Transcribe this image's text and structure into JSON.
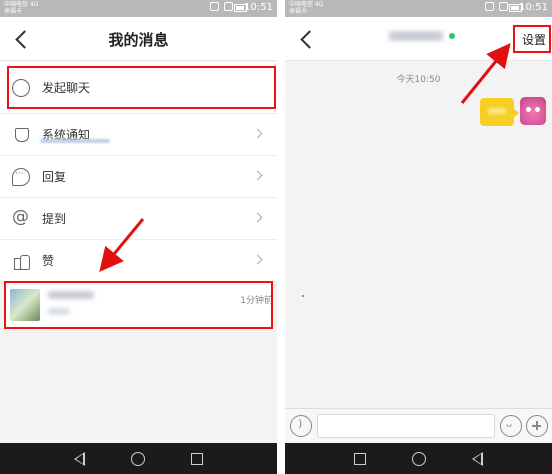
{
  "left_screen": {
    "status": {
      "carrier_line1": "中国电信 4G",
      "carrier_line2": "来福卡",
      "time": "10:51"
    },
    "title": "我的消息",
    "rows": [
      {
        "label": "发起聊天",
        "icon": "chat-bubble-icon"
      },
      {
        "label": "系统通知",
        "icon": "bell-icon"
      },
      {
        "label": "回复",
        "icon": "comment-icon"
      },
      {
        "label": "提到",
        "icon": "at-icon"
      },
      {
        "label": "赞",
        "icon": "thumbs-up-icon"
      }
    ],
    "chat_item": {
      "time": "1分钟前"
    }
  },
  "right_screen": {
    "status": {
      "carrier_line1": "中国电信 4G",
      "carrier_line2": "来福卡",
      "time": "10:51"
    },
    "settings_label": "设置",
    "timestamp": "今天10:50"
  },
  "colors": {
    "annotation_red": "#e11111",
    "bubble_yellow": "#f5cf24",
    "online_green": "#2ec66b"
  }
}
